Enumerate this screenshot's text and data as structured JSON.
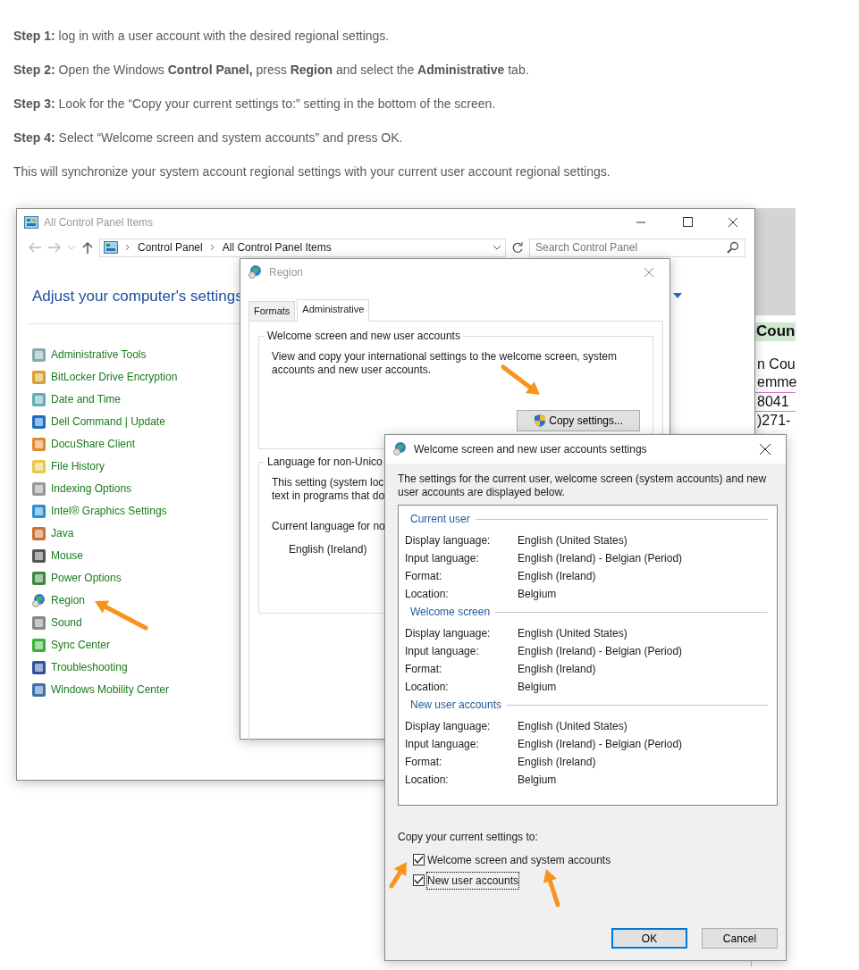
{
  "article": {
    "steps": [
      {
        "label": "Step 1:",
        "text": "log in with a user account with the desired regional settings."
      },
      {
        "label": "Step 2:",
        "text": "Open the Windows **Control Panel,** press **Region** and select the **Administrative** tab."
      },
      {
        "label": "Step 3:",
        "text": "Look for the “Copy your current settings to:” setting in the bottom of the screen."
      },
      {
        "label": "Step 4:",
        "text": "Select “Welcome screen and system accounts” and press OK."
      }
    ],
    "note": "This will synchronize your system account regional settings with your current user account regional settings."
  },
  "background_document": {
    "lines": [
      {
        "text": "Coun",
        "kind": "heading"
      },
      {
        "text": "n Cou",
        "kind": "plain"
      },
      {
        "text": "emme",
        "kind": "plain"
      },
      {
        "text": "8041",
        "kind": "highlighted"
      },
      {
        "text": ")271-",
        "kind": "plain"
      }
    ]
  },
  "control_panel": {
    "title": "All Control Panel Items",
    "breadcrumb": [
      "Control Panel",
      "All Control Panel Items"
    ],
    "search": {
      "placeholder": "Search Control Panel"
    },
    "heading": "Adjust your computer's settings",
    "items": [
      "Administrative Tools",
      "BitLocker Drive Encryption",
      "Date and Time",
      "Dell Command | Update",
      "DocuShare Client",
      "File History",
      "Indexing Options",
      "Intel® Graphics Settings",
      "Java",
      "Mouse",
      "Power Options",
      "Region",
      "Sound",
      "Sync Center",
      "Troubleshooting",
      "Windows Mobility Center"
    ]
  },
  "region_dialog": {
    "title": "Region",
    "tabs": [
      {
        "label": "Formats",
        "selected": false
      },
      {
        "label": "Administrative",
        "selected": true
      }
    ],
    "welcome_group": {
      "title": "Welcome screen and new user accounts",
      "text": "View and copy your international settings to the welcome screen, system accounts and new user accounts.",
      "button": "Copy settings..."
    },
    "language_group": {
      "title": "Language for non-Unico",
      "lines": [
        "This setting (system loc",
        "text in programs that do"
      ],
      "current_label": "Current language for no",
      "current_value": "English (Ireland)"
    }
  },
  "settings_dialog": {
    "title": "Welcome screen and new user accounts settings",
    "description": "The settings for the current user, welcome screen (system accounts) and new user accounts are displayed below.",
    "sections": [
      {
        "title": "Current user",
        "rows": [
          {
            "label": "Display language:",
            "value": "English (United States)"
          },
          {
            "label": "Input language:",
            "value": "English (Ireland) - Belgian (Period)"
          },
          {
            "label": "Format:",
            "value": "English (Ireland)"
          },
          {
            "label": "Location:",
            "value": "Belgium"
          }
        ]
      },
      {
        "title": "Welcome screen",
        "rows": [
          {
            "label": "Display language:",
            "value": "English (United States)"
          },
          {
            "label": "Input language:",
            "value": "English (Ireland) - Belgian (Period)"
          },
          {
            "label": "Format:",
            "value": "English (Ireland)"
          },
          {
            "label": "Location:",
            "value": "Belgium"
          }
        ]
      },
      {
        "title": "New user accounts",
        "rows": [
          {
            "label": "Display language:",
            "value": "English (United States)"
          },
          {
            "label": "Input language:",
            "value": "English (Ireland) - Belgian (Period)"
          },
          {
            "label": "Format:",
            "value": "English (Ireland)"
          },
          {
            "label": "Location:",
            "value": "Belgium"
          }
        ]
      }
    ],
    "copy_label": "Copy your current settings to:",
    "options": [
      {
        "label": "Welcome screen and system accounts",
        "checked": true,
        "focused": false
      },
      {
        "label": "New user accounts",
        "checked": true,
        "focused": true
      }
    ],
    "buttons": [
      {
        "label": "OK",
        "default": true
      },
      {
        "label": "Cancel",
        "default": false
      }
    ]
  }
}
